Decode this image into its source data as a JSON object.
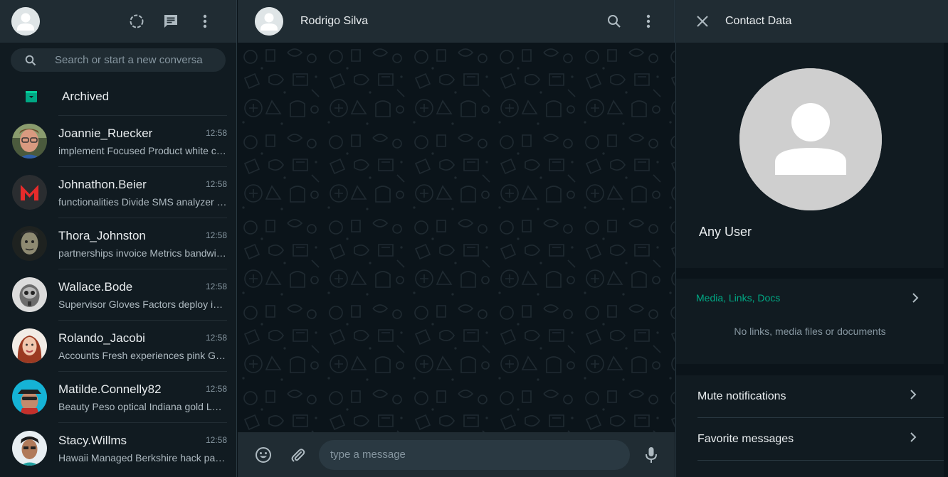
{
  "left": {
    "search_placeholder": "Search or start a new conversa",
    "archived_label": "Archived",
    "chats": [
      {
        "name": "Joannie_Ruecker",
        "time": "12:58",
        "preview": "implement Focused Product white cohesive"
      },
      {
        "name": "Johnathon.Beier",
        "time": "12:58",
        "preview": "functionalities Divide SMS analyzer Plastic"
      },
      {
        "name": "Thora_Johnston",
        "time": "12:58",
        "preview": "partnerships invoice Metrics bandwidth bus"
      },
      {
        "name": "Wallace.Bode",
        "time": "12:58",
        "preview": "Supervisor Gloves Factors deploy interface"
      },
      {
        "name": "Rolando_Jacobi",
        "time": "12:58",
        "preview": "Accounts Fresh experiences pink Granite"
      },
      {
        "name": "Matilde.Connelly82",
        "time": "12:58",
        "preview": "Beauty Peso optical Indiana gold Loan"
      },
      {
        "name": "Stacy.Willms",
        "time": "12:58",
        "preview": "Hawaii Managed Berkshire hack payment"
      }
    ]
  },
  "middle": {
    "contact_name": "Rodrigo Silva",
    "message_placeholder": "type a message"
  },
  "right": {
    "title": "Contact Data",
    "profile_name": "Any User",
    "media_label": "Media, Links, Docs",
    "media_empty": "No links, media files or documents",
    "options": [
      {
        "label": "Mute notifications"
      },
      {
        "label": "Favorite messages"
      }
    ]
  },
  "colors": {
    "accent": "#00a884",
    "panel_bg": "#111b21",
    "header_bg": "#202c33",
    "chat_bg": "#0b141a"
  }
}
